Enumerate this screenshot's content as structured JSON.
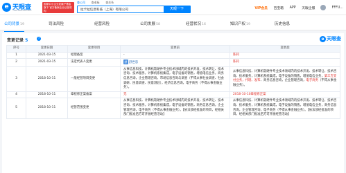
{
  "header": {
    "logo_text": "天眼查",
    "logo_sub": "TianYancha.com",
    "logo_mark": "e",
    "banner": "国家中小企业发展子基金旗下 官方备案企业征信机构",
    "search_tabs": [
      {
        "label": "查公司",
        "active": true
      },
      {
        "label": "查老板",
        "active": false
      },
      {
        "label": "查关系",
        "active": false
      }
    ],
    "search_value": "拉卡拉信息科技（上海）有限公司",
    "search_button": "天眼一下",
    "nav": {
      "vip": "VIP会员",
      "enterprise": "百宝箱",
      "app": "APP",
      "org": "天眼企服",
      "user": "FFFU..."
    }
  },
  "tabs": [
    {
      "label": "公司背景",
      "count": "19",
      "active": true
    },
    {
      "label": "司法风险",
      "count": "",
      "active": false
    },
    {
      "label": "经营风险",
      "count": "",
      "active": false
    },
    {
      "label": "公司发展",
      "count": "58",
      "active": false
    },
    {
      "label": "经营状况",
      "count": "16",
      "active": false
    },
    {
      "label": "知识产权",
      "count": "19",
      "active": false
    },
    {
      "label": "历史信息",
      "count": "",
      "active": false
    }
  ],
  "panel": {
    "title": "变更记录",
    "count": "5",
    "help_icon": "?",
    "watermark": "天眼查",
    "watermark_mark": "e"
  },
  "table": {
    "headers": [
      "序号",
      "变更日期",
      "变更项目",
      "变更前",
      "变更后"
    ],
    "rows": [
      {
        "index": "1",
        "date": "2021-03-15",
        "item": "经理备案",
        "before": [
          {
            "t": "-",
            "c": ""
          }
        ],
        "after": [
          {
            "t": "陈莉",
            "c": "hl"
          }
        ]
      },
      {
        "index": "2",
        "date": "2021-03-15",
        "item": "法定代表人变更",
        "before_badge": "舒",
        "before": [
          {
            "t": "舒世忠",
            "c": "ppl"
          }
        ],
        "after": [
          {
            "t": "陈莉",
            "c": "hl"
          }
        ]
      },
      {
        "index": "3",
        "date": "2018-10-11",
        "item": "一般经营项目变更",
        "before": [
          {
            "t": "从事信息科技、计算机软硬件专业技术领域内的技术开发、技术转让、技术咨询、技术服务，计算机系统集成，电子设备的销售，增值电信业务，商务信息咨询，企业管理咨询，市场信息咨询与调查（不得从事社会调查、社会调研、民意调查、民意测验），经济信息咨询，电子商务（不得从事金融业务）。",
            "c": ""
          }
        ],
        "after": [
          {
            "t": "从事信息科技、计算机软硬件专业技术领域内的技术开发、技术转让、技术咨询、技术服务，计算机系统集成，电子设备的销售，增值电信业务，",
            "c": ""
          },
          {
            "t": "第三方支付业务，代理、发布",
            "c": "hl"
          },
          {
            "t": "、商务信息咨询，企业管理咨询，",
            "c": ""
          },
          {
            "t": "电子商务",
            "c": "hl"
          },
          {
            "t": "（不得从事金融业务）。",
            "c": ""
          }
        ]
      },
      {
        "index": "4",
        "date": "2018-10-11",
        "item": "章程修正案备案",
        "before": [
          {
            "t": "无",
            "c": "hl"
          }
        ],
        "after": [
          {
            "t": "2018-10-10章程修正案",
            "c": "hl"
          }
        ]
      },
      {
        "index": "5",
        "date": "2018-10-11",
        "item": "经营范围变更",
        "before": [
          {
            "t": "从事信息科技、计算机软硬件专业技术领域内的技术开发、技术转让、技术咨询、技术服务，计算机系统集成，电子设备的销售，商务信息咨询，企业管理咨询，电子商务（不得从事金融业务）。【依法须经批准的项目，经相关部门批准后方可开展经营活动】",
            "c": ""
          }
        ],
        "after": [
          {
            "t": "从事信息科技、计算机软硬件专业技术领域内的技术开发、技术转让、技术咨询、技术服务，计算机系统集成，电子设备的销售，增值电信业务，商务信息咨询，企业管理咨询，电子商务（不得从事金融业务）。【依法须经批准的项目，经相关部门批准后方可开展经营活动】",
            "c": ""
          }
        ]
      }
    ]
  }
}
